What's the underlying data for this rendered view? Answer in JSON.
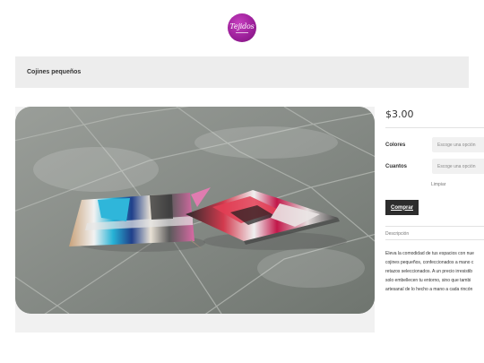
{
  "brand": {
    "logo_text": "Tejidos"
  },
  "product": {
    "title": "Cojines pequeños",
    "price": "$3.00",
    "image_alt": "Dos cojines pequeños de retazos sobre un piso de baldosas"
  },
  "options": [
    {
      "label": "Colores",
      "placeholder": "Escoge una opción"
    },
    {
      "label": "Cuantos",
      "placeholder": "Escoge una opción"
    }
  ],
  "clear_label": "Limpiar",
  "buy_label": "Comprar",
  "description": {
    "tab_label": "Descripción",
    "lines": [
      "Eleva la comodidad de tus espacios con nue",
      "cojines pequeños, confeccionados a mano c",
      "retazos seleccionados. A un precio irresistib",
      "solo embellecen tu entorno, sino que tambi",
      "artesanal de lo hecho a mano a cada rincón"
    ]
  },
  "colors": {
    "brand": "#a0229e",
    "button": "#2d2d2d",
    "title_bg": "#ededed"
  }
}
